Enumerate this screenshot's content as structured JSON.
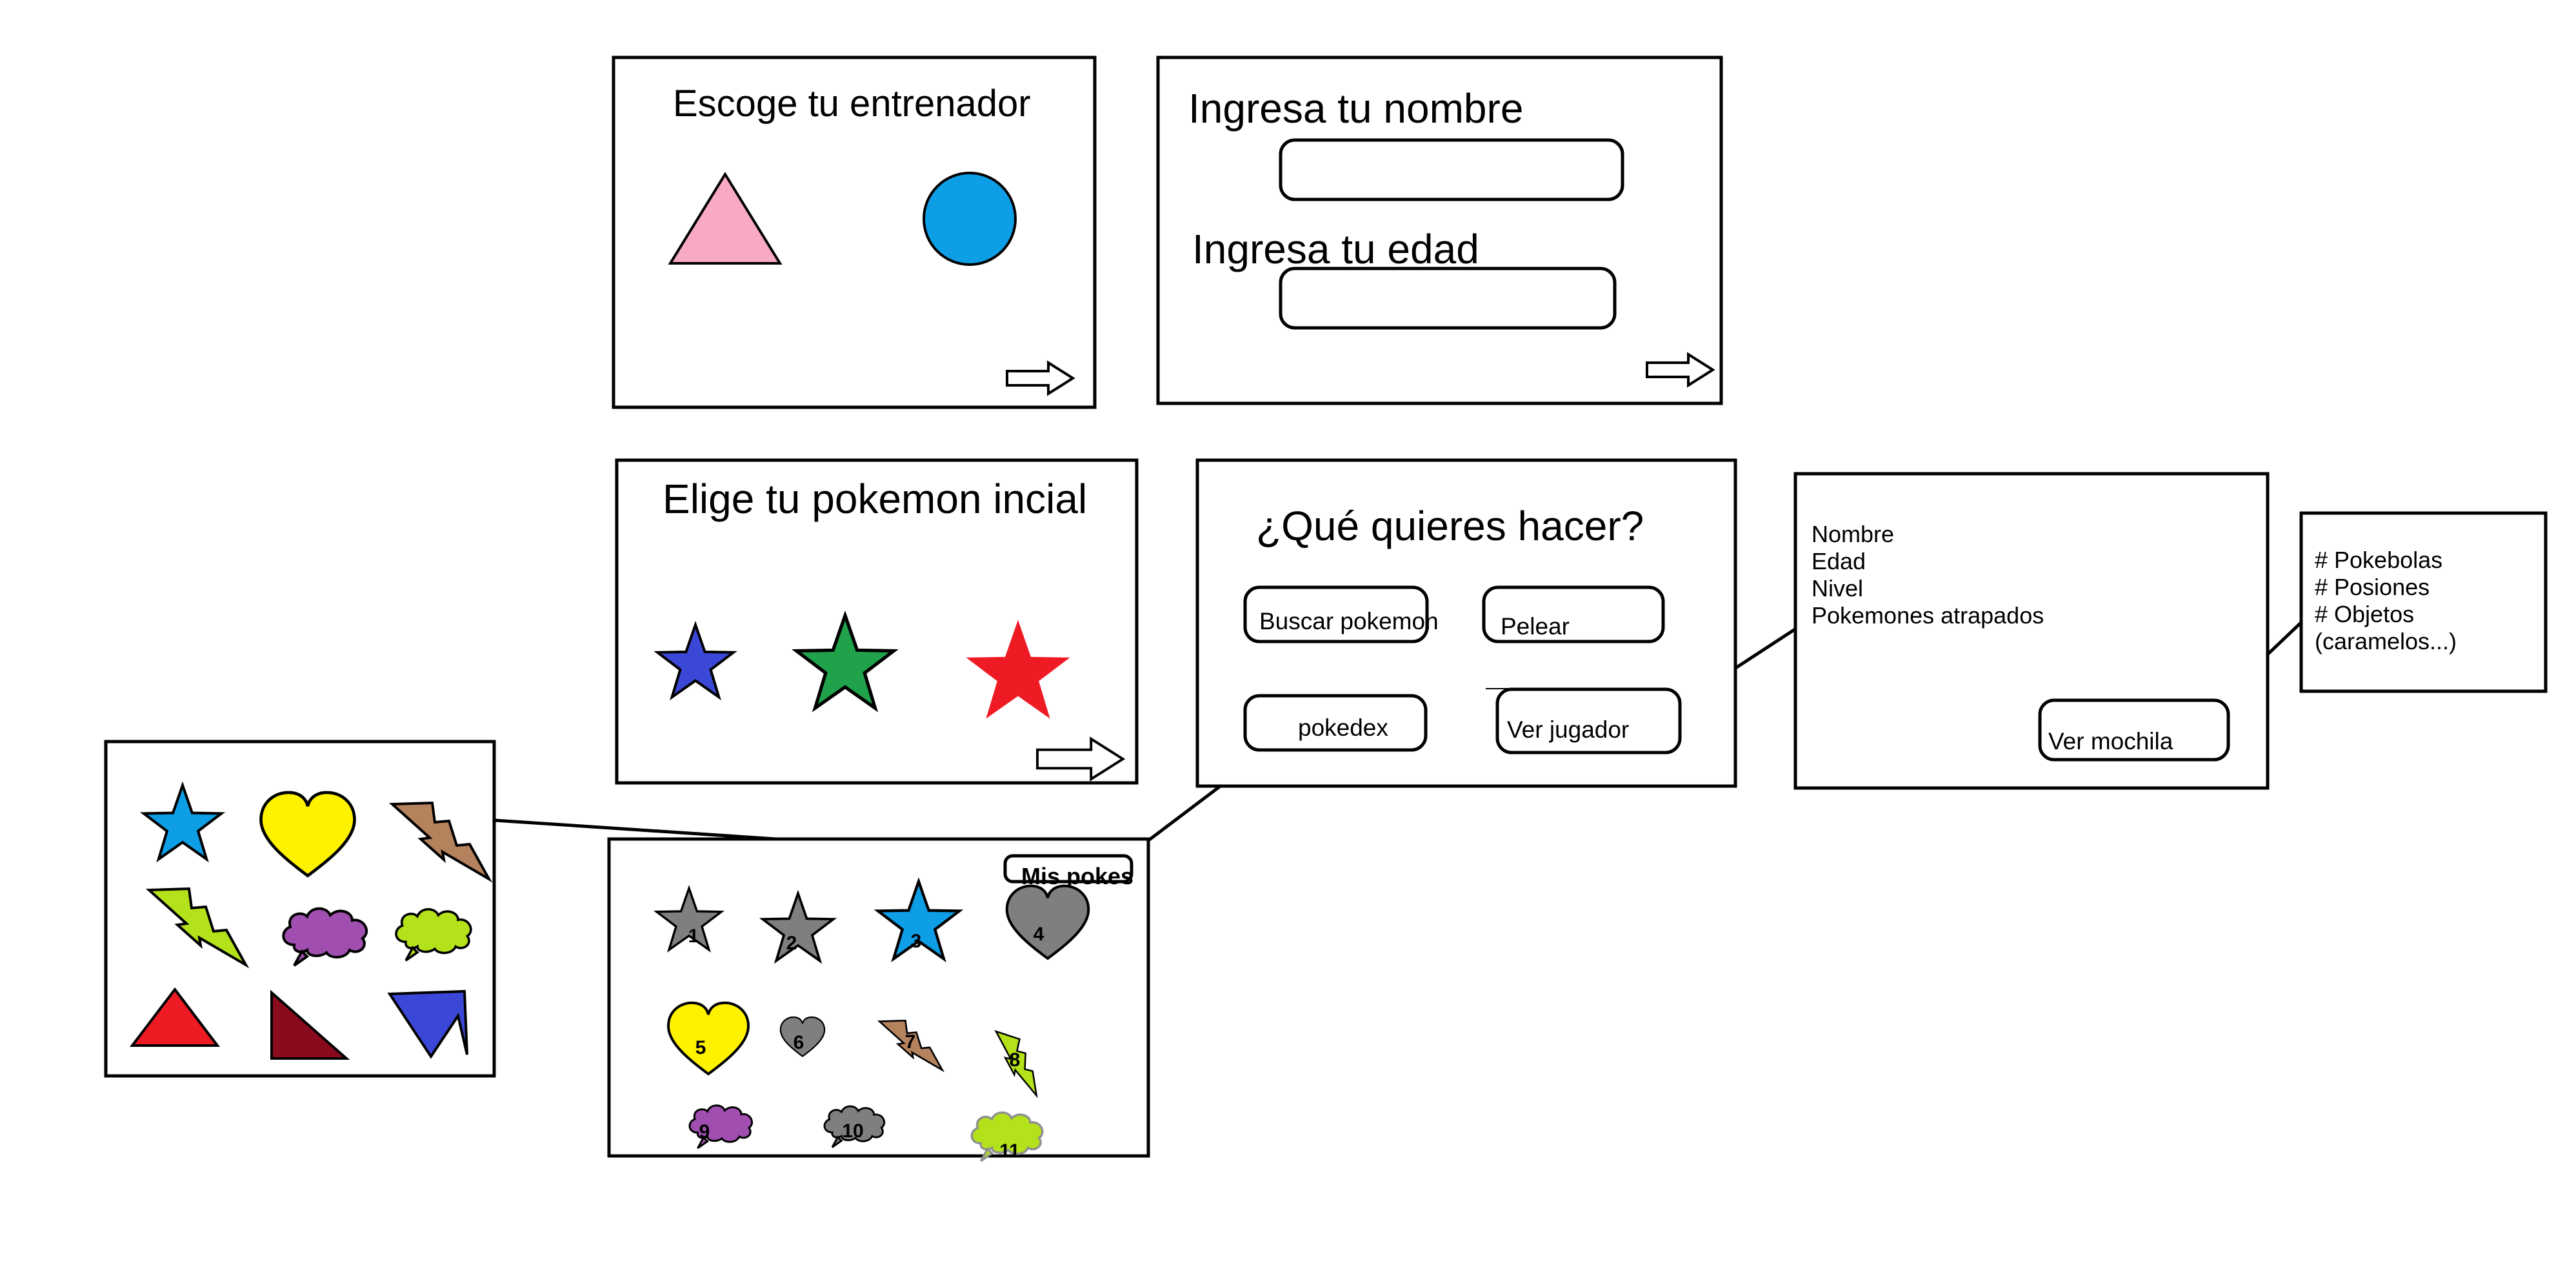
{
  "trainer_screen": {
    "title": "Escoge tu entrenador"
  },
  "name_screen": {
    "name_label": "Ingresa tu nombre",
    "age_label": "Ingresa tu edad"
  },
  "starter_screen": {
    "title": "Elige tu pokemon incial"
  },
  "menu_screen": {
    "title": "¿Qué quieres hacer?",
    "buttons": {
      "search": "Buscar pokemon",
      "fight": "Pelear",
      "pokedex": "pokedex",
      "player": "Ver jugador"
    }
  },
  "player_screen": {
    "fields": [
      "Nombre",
      "Edad",
      "Nivel",
      "Pokemones atrapados"
    ],
    "backpack_button": "Ver mochila"
  },
  "backpack_screen": {
    "items": [
      "# Pokebolas",
      "# Posiones",
      "# Objetos",
      "(caramelos...)"
    ]
  },
  "pokedex_screen": {
    "my_pokes_button": "Mis pokes",
    "numbers": [
      "1",
      "2",
      "3",
      "4",
      "5",
      "6",
      "7",
      "8",
      "9",
      "10",
      "11"
    ]
  },
  "colors": {
    "pink": "#f9a9c6",
    "blue": "#0d9ee6",
    "indigo": "#3b47d6",
    "green": "#1fa24a",
    "red": "#ee1b24",
    "yellow": "#fff200",
    "brown": "#b5825e",
    "lime": "#b4e21a",
    "purple": "#a04fb0",
    "gray": "#7f7f7f",
    "maroon": "#8a0a1e"
  },
  "icons": [
    "arrow-right-icon",
    "star-icon",
    "heart-icon",
    "lightning-icon",
    "cloud-icon",
    "triangle-icon",
    "circle-icon"
  ]
}
